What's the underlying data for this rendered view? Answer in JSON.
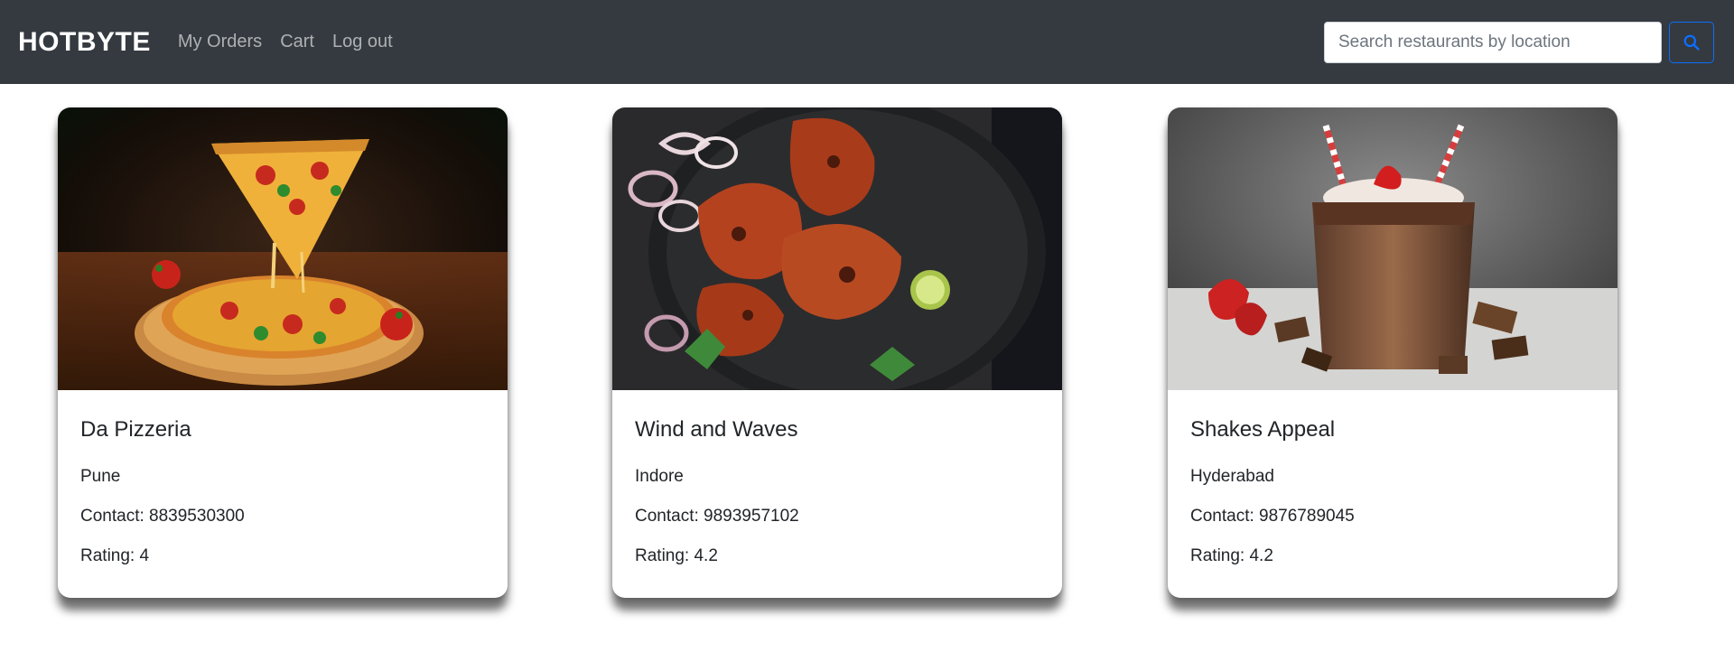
{
  "navbar": {
    "brand": "HOTBYTE",
    "links": [
      {
        "label": "My Orders"
      },
      {
        "label": "Cart"
      },
      {
        "label": "Log out"
      }
    ],
    "search": {
      "placeholder": "Search restaurants by location",
      "value": "",
      "button_icon": "search-icon"
    }
  },
  "colors": {
    "navbar_bg": "#343a40",
    "accent": "#0d6efd"
  },
  "restaurants": [
    {
      "name": "Da Pizzeria",
      "location": "Pune",
      "contact": "Contact: 8839530300",
      "rating": "Rating: 4",
      "image": "pizza-photo"
    },
    {
      "name": "Wind and Waves",
      "location": "Indore",
      "contact": "Contact: 9893957102",
      "rating": "Rating: 4.2",
      "image": "tandoori-chicken-photo"
    },
    {
      "name": "Shakes Appeal",
      "location": "Hyderabad",
      "contact": "Contact: 9876789045",
      "rating": "Rating: 4.2",
      "image": "chocolate-milkshake-photo"
    }
  ]
}
